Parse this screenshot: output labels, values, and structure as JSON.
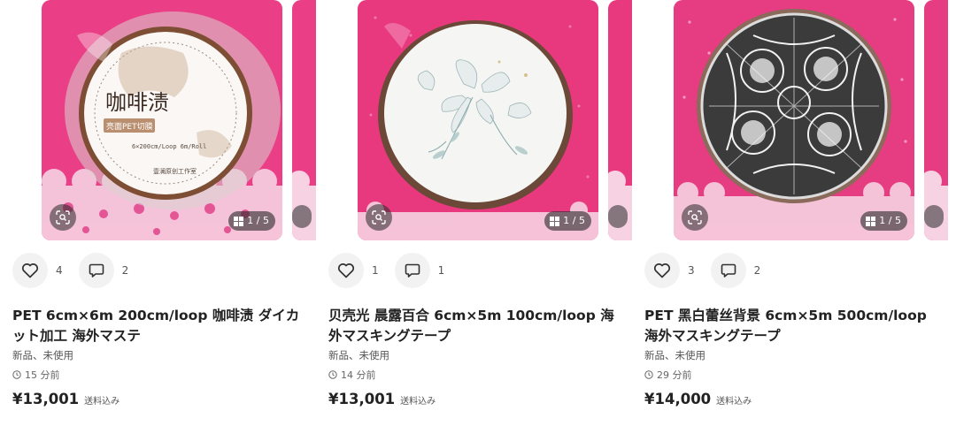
{
  "items": [
    {
      "title": "PET 6cm×6m 200cm/loop 咖啡渍 ダイカット加工 海外マステ",
      "likes": "4",
      "comments": "2",
      "condition": "新品、未使用",
      "time": "15 分前",
      "price": "¥13,001",
      "shipping": "送料込み",
      "image_page": "1 / 5",
      "image_text": {
        "name": "咖啡渍",
        "finish": "亮面PET切膜",
        "spec": "6×200cm/Loop 6m/Roll",
        "maker": "壹澜原创工作室"
      }
    },
    {
      "title": "贝壳光 晨露百合 6cm×5m 100cm/loop 海外マスキングテープ",
      "likes": "1",
      "comments": "1",
      "condition": "新品、未使用",
      "time": "14 分前",
      "price": "¥13,001",
      "shipping": "送料込み",
      "image_page": "1 / 5"
    },
    {
      "title": "PET 黑白蕾丝背景 6cm×5m 500cm/loop 海外マスキングテープ",
      "likes": "3",
      "comments": "2",
      "condition": "新品、未使用",
      "time": "29 分前",
      "price": "¥14,000",
      "shipping": "送料込み",
      "image_page": "1 / 5"
    }
  ],
  "icons": {
    "like": "heart-icon",
    "comment": "comment-icon",
    "lens": "image-search-icon",
    "gallery": "gallery-grid-icon",
    "time": "clock-icon"
  },
  "colors": {
    "pink_background": "#ea3f86",
    "lace": "#f7d2e2",
    "button_bg": "#f2f2f2"
  }
}
